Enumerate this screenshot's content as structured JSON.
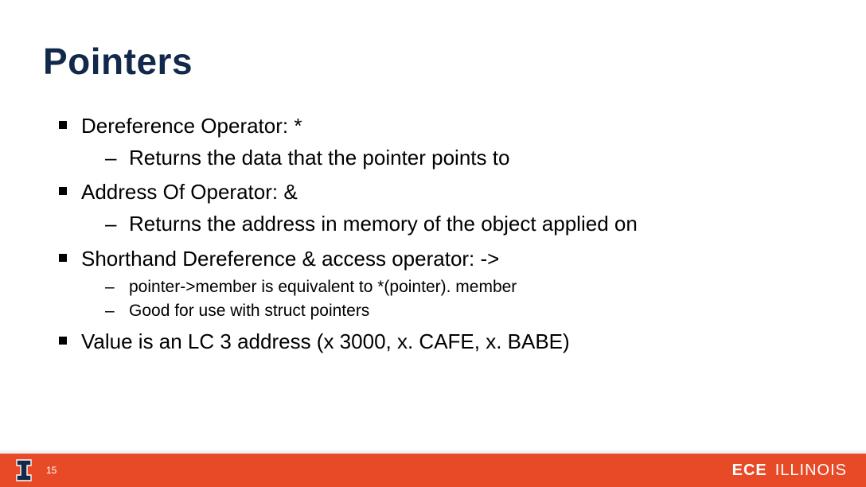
{
  "title": "Pointers",
  "bullets": {
    "b1": {
      "text": "Dereference Operator: *",
      "sub1": "Returns the data that the pointer points to"
    },
    "b2": {
      "text": "Address Of Operator: &",
      "sub1": "Returns the address in memory of the object applied on"
    },
    "b3": {
      "text": "Shorthand Dereference & access operator: ->",
      "sub1": "pointer->member is equivalent to *(pointer). member",
      "sub2": "Good for use with struct pointers"
    },
    "b4": {
      "text": "Value is an LC 3 address (x 3000, x. CAFE, x. BABE)"
    }
  },
  "footer": {
    "page": "15",
    "logo_ece": "ECE",
    "logo_illinois": "ILLINOIS"
  },
  "colors": {
    "title": "#13294B",
    "orange": "#E84A27"
  }
}
